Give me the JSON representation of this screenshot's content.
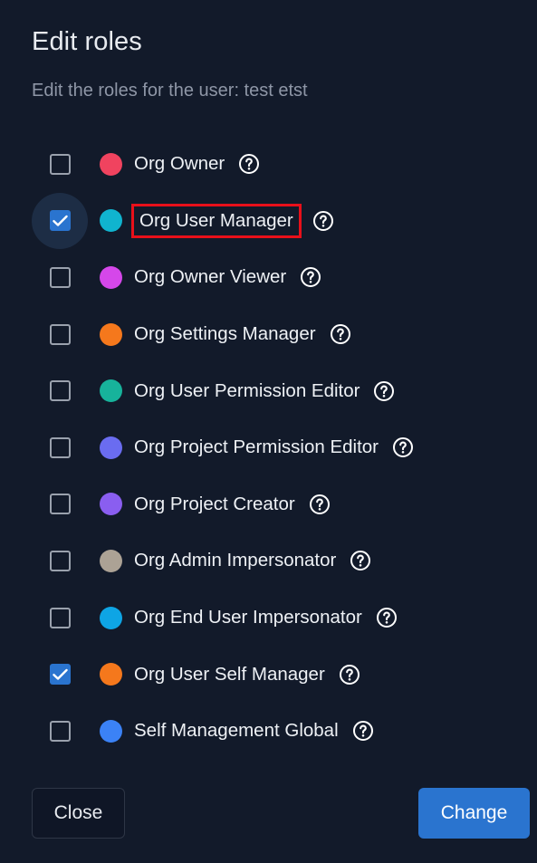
{
  "dialog": {
    "title": "Edit roles",
    "subtitle": "Edit the roles for the user: test etst"
  },
  "roles": [
    {
      "label": "Org Owner",
      "checked": false,
      "color": "#f0435f"
    },
    {
      "label": "Org User Manager",
      "checked": true,
      "color": "#10b4cf",
      "focused": true,
      "highlighted": true
    },
    {
      "label": "Org Owner Viewer",
      "checked": false,
      "color": "#d547ea"
    },
    {
      "label": "Org Settings Manager",
      "checked": false,
      "color": "#f5781c"
    },
    {
      "label": "Org User Permission Editor",
      "checked": false,
      "color": "#17b39b"
    },
    {
      "label": "Org Project Permission Editor",
      "checked": false,
      "color": "#6a6cf0"
    },
    {
      "label": "Org Project Creator",
      "checked": false,
      "color": "#8a5ef0"
    },
    {
      "label": "Org Admin Impersonator",
      "checked": false,
      "color": "#aca295"
    },
    {
      "label": "Org End User Impersonator",
      "checked": false,
      "color": "#0ea5e5"
    },
    {
      "label": "Org User Self Manager",
      "checked": true,
      "color": "#f5781c"
    },
    {
      "label": "Self Management Global",
      "checked": false,
      "color": "#3b82f6"
    }
  ],
  "icons": {
    "checkbox_check": "check-icon",
    "help": "help-circle-icon"
  },
  "buttons": {
    "close_label": "Close",
    "change_label": "Change"
  },
  "colors": {
    "background": "#121a2a",
    "primary": "#2a74cf",
    "highlight_box": "#e8101a"
  }
}
